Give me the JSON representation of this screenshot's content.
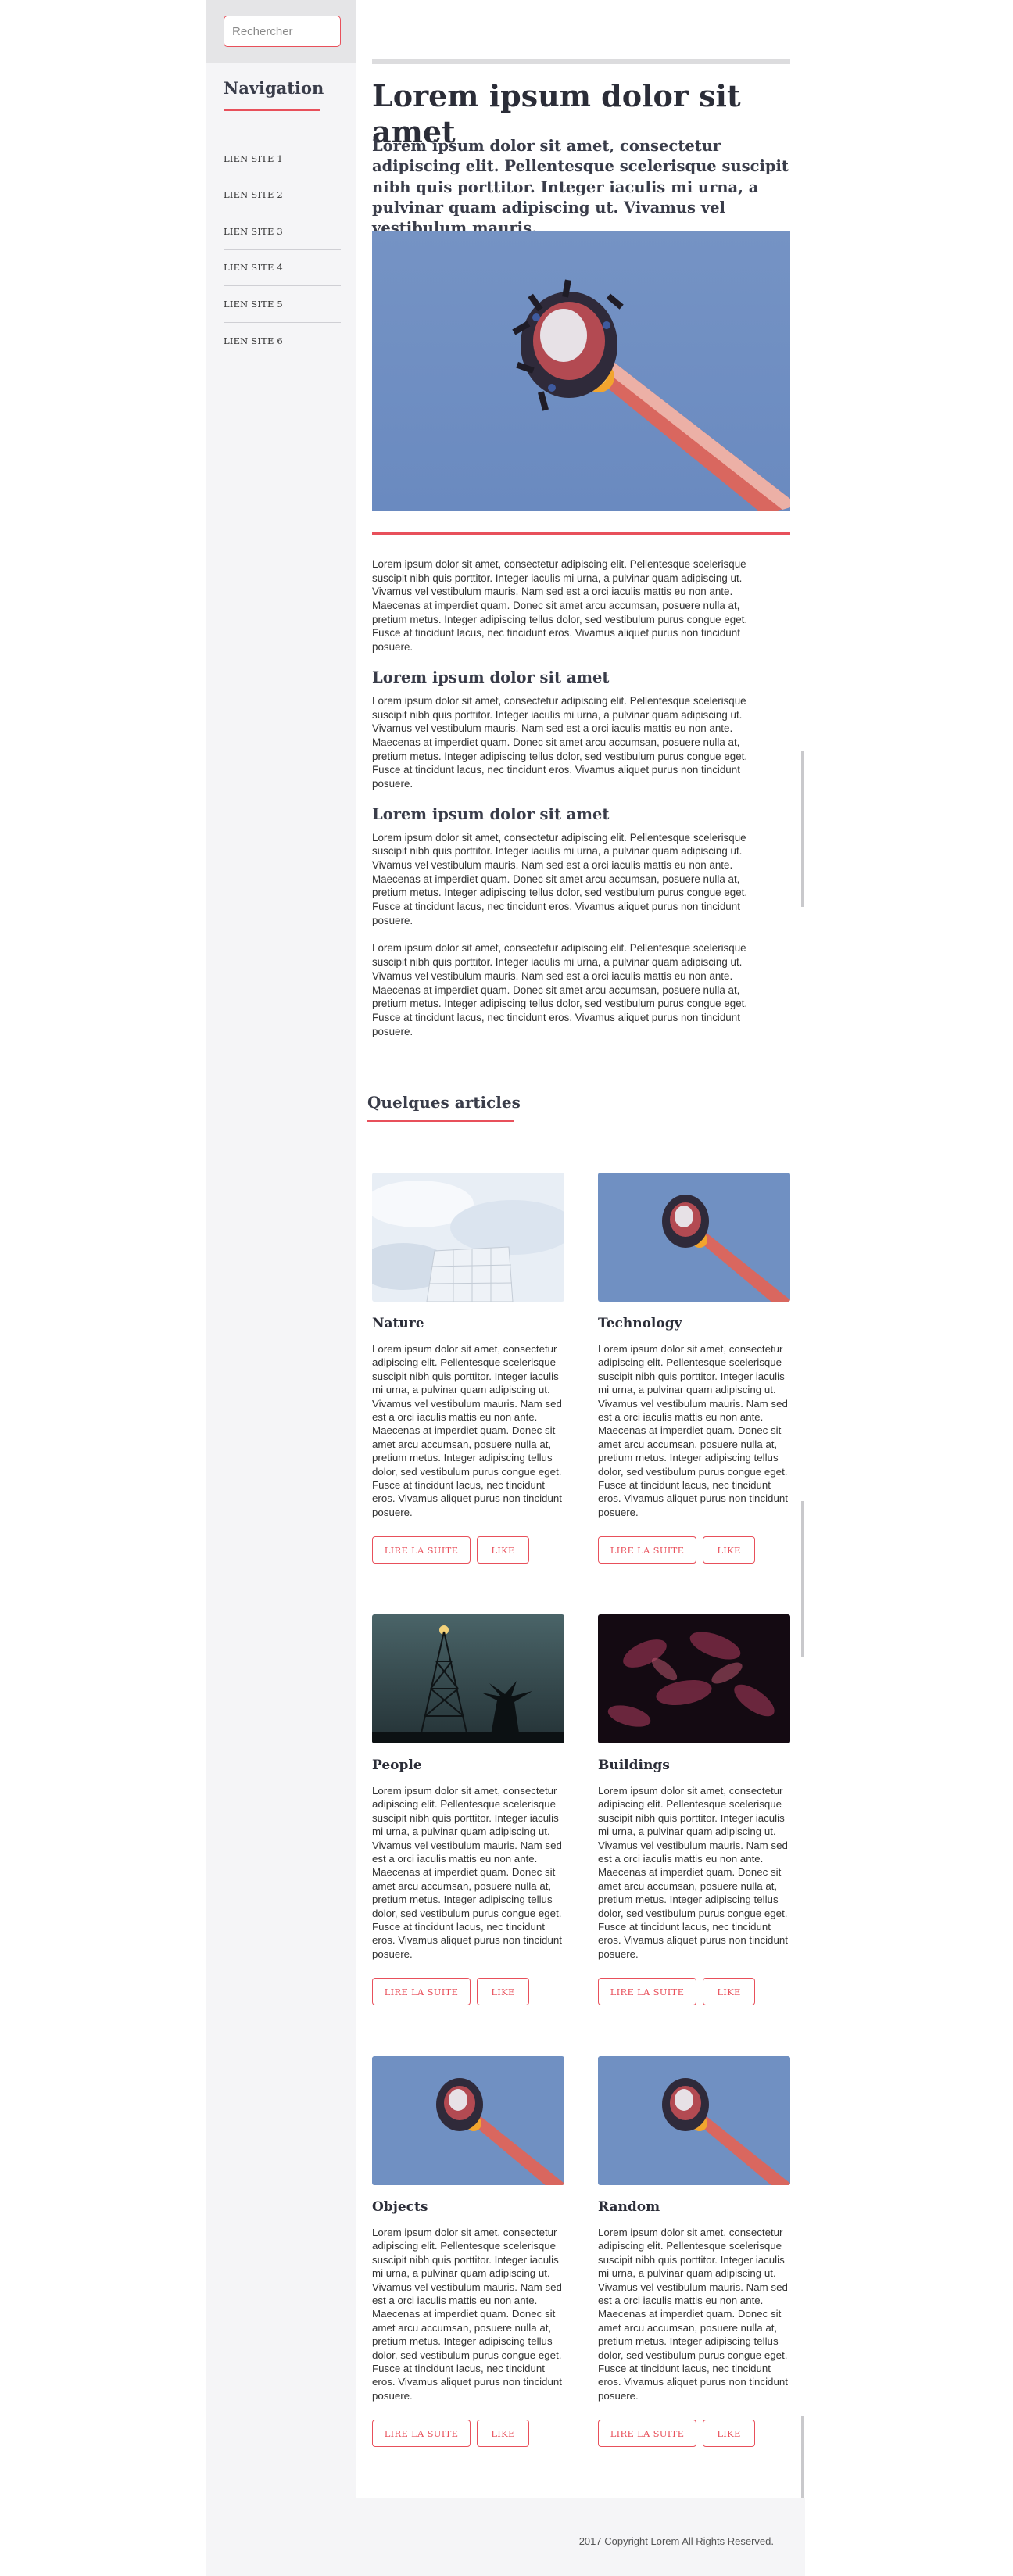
{
  "search": {
    "placeholder": "Rechercher"
  },
  "sidebar": {
    "title": "Navigation",
    "items": [
      {
        "label": "LIEN SITE 1"
      },
      {
        "label": "LIEN SITE 2"
      },
      {
        "label": "LIEN SITE 3"
      },
      {
        "label": "LIEN SITE 4"
      },
      {
        "label": "LIEN SITE 5"
      },
      {
        "label": "LIEN SITE 6"
      }
    ]
  },
  "main": {
    "title": "Lorem ipsum dolor sit amet",
    "lead": "Lorem ipsum dolor sit amet, consectetur adipiscing elit. Pellentesque scelerisque suscipit nibh quis porttitor. Integer iaculis mi urna, a pulvinar quam adipiscing ut. Vivamus vel vestibulum mauris.",
    "paragraph": "Lorem ipsum dolor sit amet, consectetur adipiscing elit. Pellentesque scelerisque suscipit nibh quis porttitor. Integer iaculis mi urna, a pulvinar quam adipiscing ut. Vivamus vel vestibulum mauris. Nam sed est a orci iaculis mattis eu non ante. Maecenas at imperdiet quam. Donec sit amet arcu accumsan, posuere nulla at, pretium metus. Integer adipiscing tellus dolor, sed vestibulum purus congue eget. Fusce at tincidunt lacus, nec tincidunt eros. Vivamus aliquet purus non tincidunt posuere.",
    "subheading_1": "Lorem ipsum dolor sit amet",
    "subheading_2": "Lorem ipsum dolor sit amet"
  },
  "articles": {
    "section_title": "Quelques articles",
    "card_text": "Lorem ipsum dolor sit amet, consectetur adipiscing elit. Pellentesque scelerisque suscipit nibh quis porttitor. Integer iaculis mi urna, a pulvinar quam adipiscing ut. Vivamus vel vestibulum mauris. Nam sed est a orci iaculis mattis eu non ante. Maecenas at imperdiet quam. Donec sit amet arcu accumsan, posuere nulla at, pretium metus. Integer adipiscing tellus dolor, sed vestibulum purus congue eget. Fusce at tincidunt lacus, nec tincidunt eros. Vivamus aliquet purus non tincidunt posuere.",
    "read_more_label": "LIRE LA SUITE",
    "like_label": "LIKE",
    "items": [
      {
        "title": "Nature"
      },
      {
        "title": "Technology"
      },
      {
        "title": "People"
      },
      {
        "title": "Buildings"
      },
      {
        "title": "Objects"
      },
      {
        "title": "Random"
      }
    ]
  },
  "footer": {
    "copyright": "2017 Copyright Lorem All Rights Reserved."
  },
  "colors": {
    "accent": "#e8505b",
    "sidebar_bg": "#f5f5f7",
    "heading": "#2b2d38"
  }
}
